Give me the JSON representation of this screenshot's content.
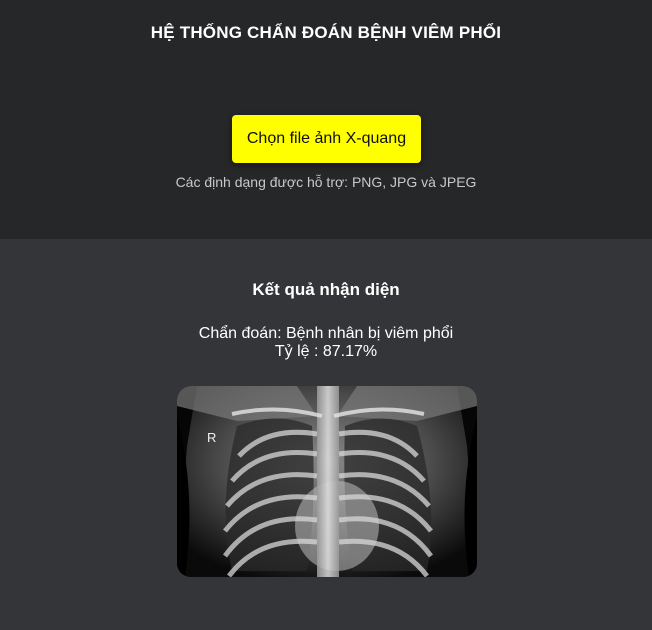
{
  "header": {
    "title": "HỆ THỐNG CHẨN ĐOÁN BỆNH VIÊM PHỔI",
    "upload_label": "Chọn file ảnh X-quang",
    "formats_text": "Các định dạng được hỗ trợ: PNG, JPG và JPEG"
  },
  "result": {
    "title": "Kết quả nhận diện",
    "diagnosis": "Chẩn đoán: Bệnh nhân bị viêm phổi",
    "ratio": "Tỷ lệ : 87.17%",
    "image_marker": "R"
  },
  "colors": {
    "top_bg": "#262729",
    "bottom_bg": "#343538",
    "button": "#ffff00"
  }
}
